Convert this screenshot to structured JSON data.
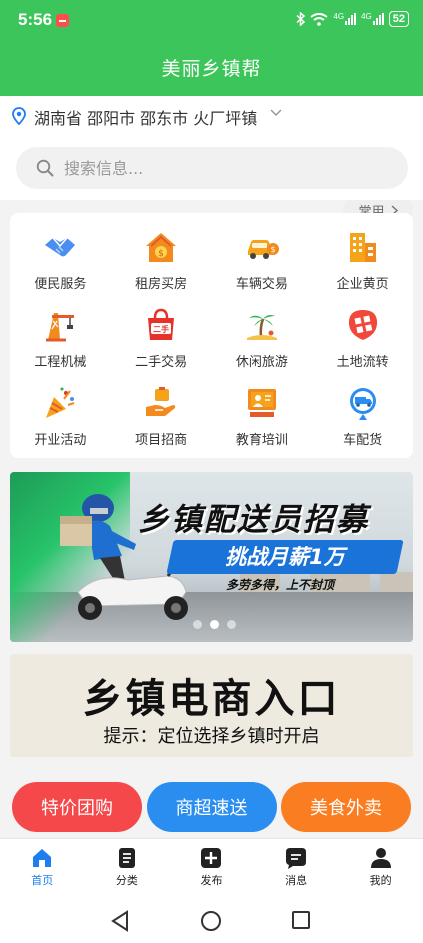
{
  "status_bar": {
    "time": "5:56",
    "signal_1": "4G",
    "signal_2": "4G",
    "battery": "52"
  },
  "app_bar": {
    "title": "美丽乡镇帮"
  },
  "location": {
    "text": "湖南省 邵阳市 邵东市 火厂坪镇",
    "common_label": "常用"
  },
  "search": {
    "placeholder": "搜索信息..."
  },
  "categories": [
    {
      "label": "便民服务",
      "icon": "handshake-icon"
    },
    {
      "label": "租房买房",
      "icon": "house-icon"
    },
    {
      "label": "车辆交易",
      "icon": "car-icon"
    },
    {
      "label": "企业黄页",
      "icon": "building-icon"
    },
    {
      "label": "工程机械",
      "icon": "crane-icon"
    },
    {
      "label": "二手交易",
      "icon": "secondhand-icon"
    },
    {
      "label": "休闲旅游",
      "icon": "palm-tree-icon"
    },
    {
      "label": "土地流转",
      "icon": "land-icon"
    },
    {
      "label": "开业活动",
      "icon": "party-popper-icon"
    },
    {
      "label": "项目招商",
      "icon": "investment-icon"
    },
    {
      "label": "教育培训",
      "icon": "teacher-icon"
    },
    {
      "label": "车配货",
      "icon": "truck-location-icon"
    }
  ],
  "banner_recruit": {
    "headline": "乡镇配送员招募",
    "pill": "挑战月薪1万",
    "slogan": "多劳多得，上不封顶",
    "dots": 3,
    "active_dot": 1
  },
  "banner_ecommerce": {
    "title": "乡镇电商入口",
    "hint": "提示：定位选择乡镇时开启"
  },
  "quick_actions": [
    {
      "label": "特价团购",
      "color": "#f5484a"
    },
    {
      "label": "商超速送",
      "color": "#2a8ef0"
    },
    {
      "label": "美食外卖",
      "color": "#fb7d22"
    }
  ],
  "tabbar": [
    {
      "label": "首页",
      "icon": "home-icon",
      "active": true
    },
    {
      "label": "分类",
      "icon": "list-icon",
      "active": false
    },
    {
      "label": "发布",
      "icon": "plus-square-icon",
      "active": false
    },
    {
      "label": "消息",
      "icon": "message-icon",
      "active": false
    },
    {
      "label": "我的",
      "icon": "user-icon",
      "active": false
    }
  ],
  "colors": {
    "primary_green": "#3cc55a",
    "active_blue": "#1e7ef0",
    "icon_orange": "#f28a1e"
  }
}
